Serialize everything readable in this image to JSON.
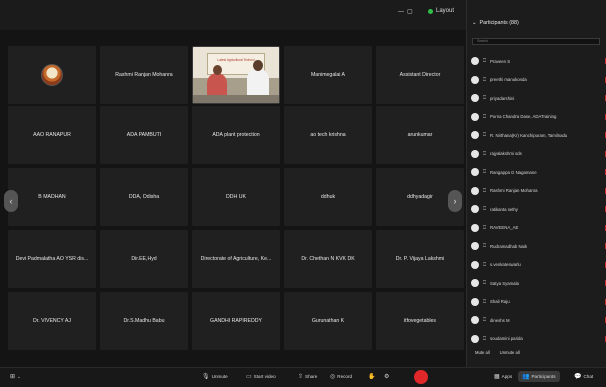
{
  "topbar": {
    "view_label": "Layout"
  },
  "gallery": {
    "tiles": [
      {
        "label": "",
        "type": "avatar"
      },
      {
        "label": "Rashmi Ranjan Mohanra",
        "type": "name"
      },
      {
        "label": "",
        "type": "video"
      },
      {
        "label": "Manimegalai A",
        "type": "name"
      },
      {
        "label": "Assistant Director",
        "type": "name"
      },
      {
        "label": "AAO RANAPUR",
        "type": "name"
      },
      {
        "label": "ADA PAMBUTI",
        "type": "name"
      },
      {
        "label": "ADA plant protection",
        "type": "name"
      },
      {
        "label": "ao tech krishna",
        "type": "name"
      },
      {
        "label": "arunkumar",
        "type": "name"
      },
      {
        "label": "B MADHAN",
        "type": "name"
      },
      {
        "label": "DDA, Odisha",
        "type": "name"
      },
      {
        "label": "DDH UK",
        "type": "name"
      },
      {
        "label": "ddhuk",
        "type": "name"
      },
      {
        "label": "ddhyadagir",
        "type": "name"
      },
      {
        "label": "Devi Padmalatha AO YSR dis...",
        "type": "name"
      },
      {
        "label": "Dir.EE,Hyd",
        "type": "name"
      },
      {
        "label": "Directorate of Agriculture, Ke...",
        "type": "name"
      },
      {
        "label": "Dr. Chethan N KVK DK",
        "type": "name"
      },
      {
        "label": "Dr. P. Vijaya Lakshmi",
        "type": "name"
      },
      {
        "label": "Dr. VIVENCY AJ",
        "type": "name"
      },
      {
        "label": "Dr.S.Madhu Babu",
        "type": "name"
      },
      {
        "label": "GANDHI RAPIREDDY",
        "type": "name"
      },
      {
        "label": "Gurunathan K",
        "type": "name"
      },
      {
        "label": "itfovegetables",
        "type": "name"
      }
    ],
    "video_banner_text": "Latest Agricultural Technol"
  },
  "panel": {
    "title": "Participants (88)",
    "search_placeholder": "Search",
    "participants": [
      "Praveen S",
      "preethi manukonda",
      "priyadarshini",
      "Purna Chandra Dase, ADATraining",
      "R. Nirthana(Kr) Kanchipuram, Tamilnadu",
      "rajyalakshmi sds",
      "Rangappa G Nagamane",
      "Rashmi Ranjan Mohanra",
      "ratikanta sethy",
      "RAVEENA_AE",
      "Rudramadhab Naik",
      "s.venkateswarlu",
      "Satya Syamala",
      "Shali Raju",
      "dineshs M",
      "soudamini parida"
    ],
    "footer": {
      "mute_all": "Mute all",
      "unmute_all": "Unmute all"
    }
  },
  "toolbar": {
    "unmute": "Unmute",
    "start_video": "Start video",
    "share": "Share",
    "record": "Record",
    "apps": "Apps",
    "participants": "Participants",
    "chat": "Chat"
  },
  "colors": {
    "end_button": "#e0282a",
    "mic_muted": "#cf2b2b"
  }
}
